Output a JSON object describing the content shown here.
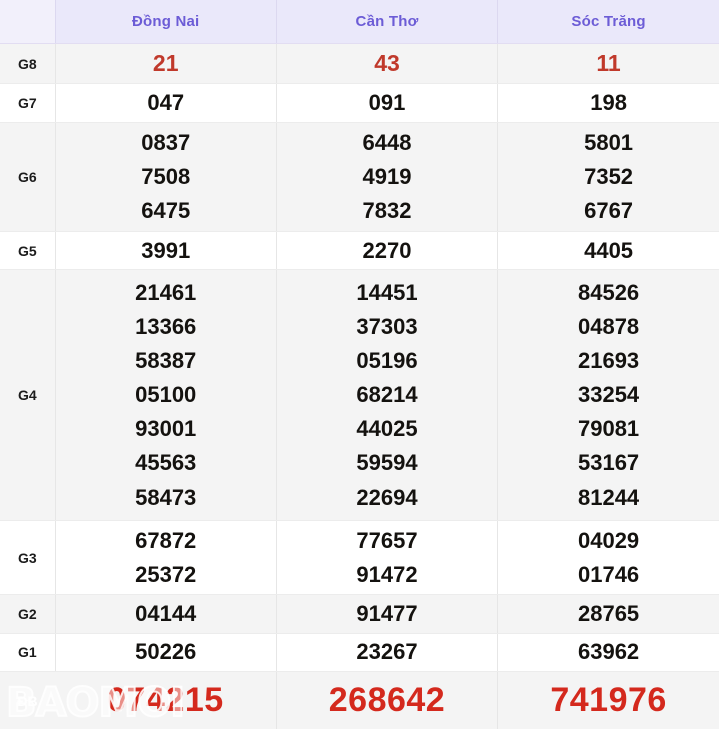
{
  "table": {
    "corner_label": "",
    "provinces": [
      "Đồng Nai",
      "Cần Thơ",
      "Sóc Trăng"
    ],
    "accent_header_bg": "#eae8fa",
    "accent_header_text": "#6c5cd6",
    "special_red": "#d4291d",
    "g8_red": "#c0392b",
    "db_cell_bg": "#e2564f",
    "rows": [
      {
        "prize": "G8",
        "values": [
          [
            "21"
          ],
          [
            "43"
          ],
          [
            "11"
          ]
        ]
      },
      {
        "prize": "G7",
        "values": [
          [
            "047"
          ],
          [
            "091"
          ],
          [
            "198"
          ]
        ]
      },
      {
        "prize": "G6",
        "values": [
          [
            "0837",
            "7508",
            "6475"
          ],
          [
            "6448",
            "4919",
            "7832"
          ],
          [
            "5801",
            "7352",
            "6767"
          ]
        ]
      },
      {
        "prize": "G5",
        "values": [
          [
            "3991"
          ],
          [
            "2270"
          ],
          [
            "4405"
          ]
        ]
      },
      {
        "prize": "G4",
        "values": [
          [
            "21461",
            "13366",
            "58387",
            "05100",
            "93001",
            "45563",
            "58473"
          ],
          [
            "14451",
            "37303",
            "05196",
            "68214",
            "44025",
            "59594",
            "22694"
          ],
          [
            "84526",
            "04878",
            "21693",
            "33254",
            "79081",
            "53167",
            "81244"
          ]
        ]
      },
      {
        "prize": "G3",
        "values": [
          [
            "67872",
            "25372"
          ],
          [
            "77657",
            "91472"
          ],
          [
            "04029",
            "01746"
          ]
        ]
      },
      {
        "prize": "G2",
        "values": [
          [
            "04144"
          ],
          [
            "91477"
          ],
          [
            "28765"
          ]
        ]
      },
      {
        "prize": "G1",
        "values": [
          [
            "50226"
          ],
          [
            "23267"
          ],
          [
            "63962"
          ]
        ]
      }
    ],
    "special_row": {
      "prize": "ĐB",
      "values": [
        "074215",
        "268642",
        "741976"
      ]
    },
    "watermark": "BAOMOI"
  }
}
